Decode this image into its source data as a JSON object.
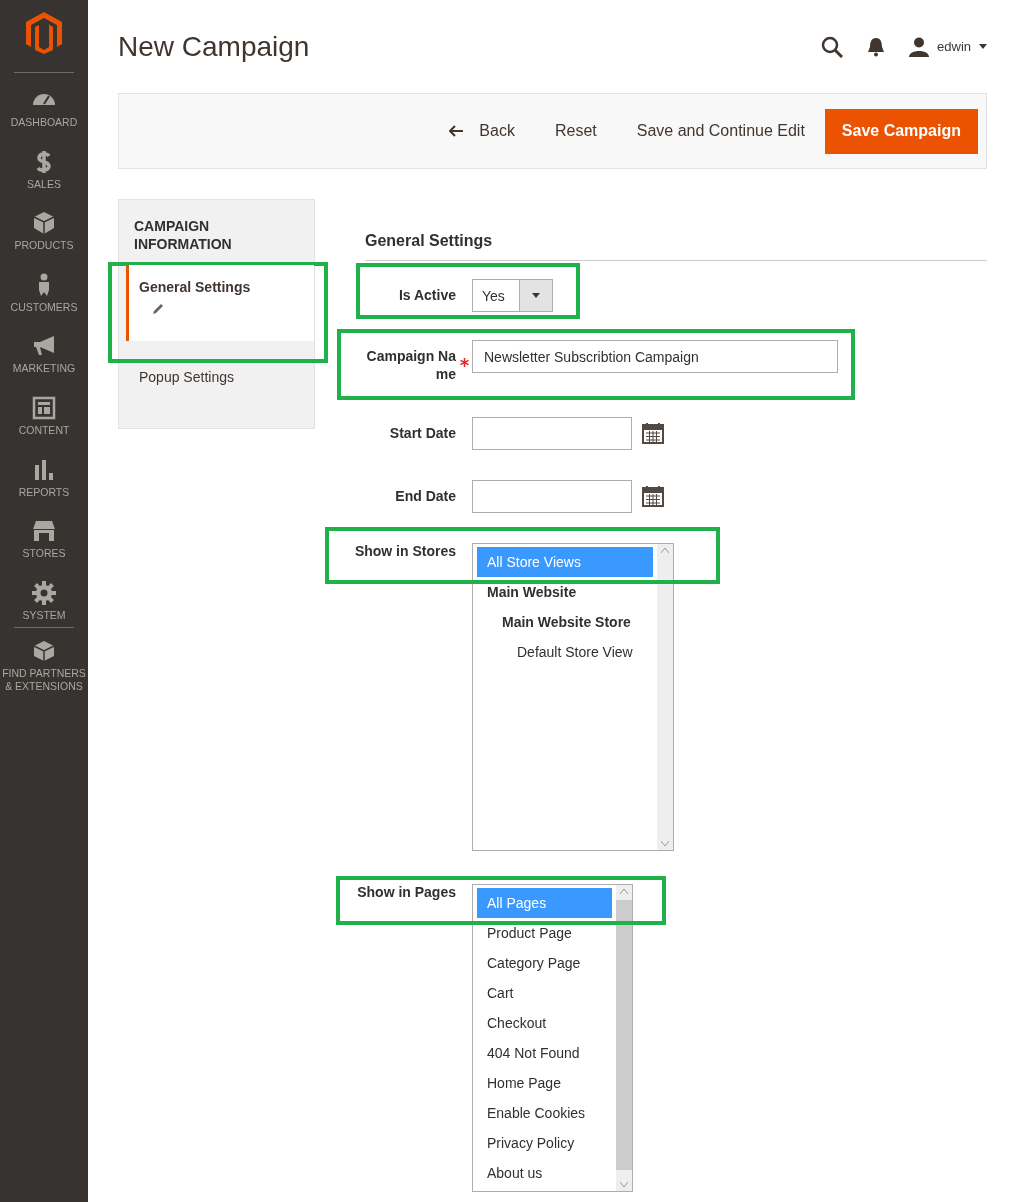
{
  "sidebar": {
    "items": [
      {
        "label": "DASHBOARD",
        "kind": "dashboard"
      },
      {
        "label": "SALES",
        "kind": "sales"
      },
      {
        "label": "PRODUCTS",
        "kind": "products"
      },
      {
        "label": "CUSTOMERS",
        "kind": "customers"
      },
      {
        "label": "MARKETING",
        "kind": "marketing"
      },
      {
        "label": "CONTENT",
        "kind": "content"
      },
      {
        "label": "REPORTS",
        "kind": "reports"
      },
      {
        "label": "STORES",
        "kind": "stores"
      },
      {
        "label": "SYSTEM",
        "kind": "system"
      },
      {
        "label": "FIND PARTNERS & EXTENSIONS",
        "kind": "partners"
      }
    ]
  },
  "header": {
    "title": "New Campaign",
    "user": "edwin"
  },
  "actions": [
    {
      "label": "Back",
      "kind": "back"
    },
    {
      "label": "Reset",
      "kind": "plain"
    },
    {
      "label": "Save and Continue Edit",
      "kind": "plain"
    },
    {
      "label": "Save Campaign",
      "kind": "primary"
    }
  ],
  "tabs": {
    "title": "CAMPAIGN INFORMATION",
    "items": [
      {
        "label": "General Settings",
        "selected": true,
        "changed": true,
        "highlighted": true
      },
      {
        "label": "Popup Settings",
        "selected": false,
        "changed": false,
        "highlighted": false
      }
    ]
  },
  "form": {
    "title": "General Settings",
    "fields": [
      {
        "kind": "select",
        "label": "Is Active",
        "value": "Yes",
        "required": false,
        "highlighted": true
      },
      {
        "kind": "text",
        "label": "Campaign Name",
        "value": "Newsletter Subscribtion Campaign",
        "required": true,
        "highlighted": true
      },
      {
        "kind": "date",
        "label": "Start Date",
        "required": false,
        "highlighted": false
      },
      {
        "kind": "date",
        "label": "End Date",
        "required": false,
        "highlighted": false
      },
      {
        "kind": "stores",
        "label": "Show in Stores",
        "required": false,
        "highlighted": true,
        "options": [
          {
            "label": "All Store Views",
            "selected": true
          },
          {
            "label": "Main Website",
            "selected": false,
            "children": [
              {
                "label": "Main Website Store",
                "selected": false,
                "children": [
                  {
                    "label": "Default Store View",
                    "selected": false
                  }
                ]
              }
            ]
          }
        ]
      },
      {
        "kind": "pages",
        "label": "Show in Pages",
        "required": false,
        "highlighted": true,
        "options": [
          {
            "label": "All Pages",
            "selected": true
          },
          {
            "label": "Product Page",
            "selected": false
          },
          {
            "label": "Category Page",
            "selected": false
          },
          {
            "label": "Cart",
            "selected": false
          },
          {
            "label": "Checkout",
            "selected": false
          },
          {
            "label": "404 Not Found",
            "selected": false
          },
          {
            "label": "Home Page",
            "selected": false
          },
          {
            "label": "Enable Cookies",
            "selected": false
          },
          {
            "label": "Privacy Policy",
            "selected": false
          },
          {
            "label": "About us",
            "selected": false
          }
        ]
      }
    ]
  }
}
